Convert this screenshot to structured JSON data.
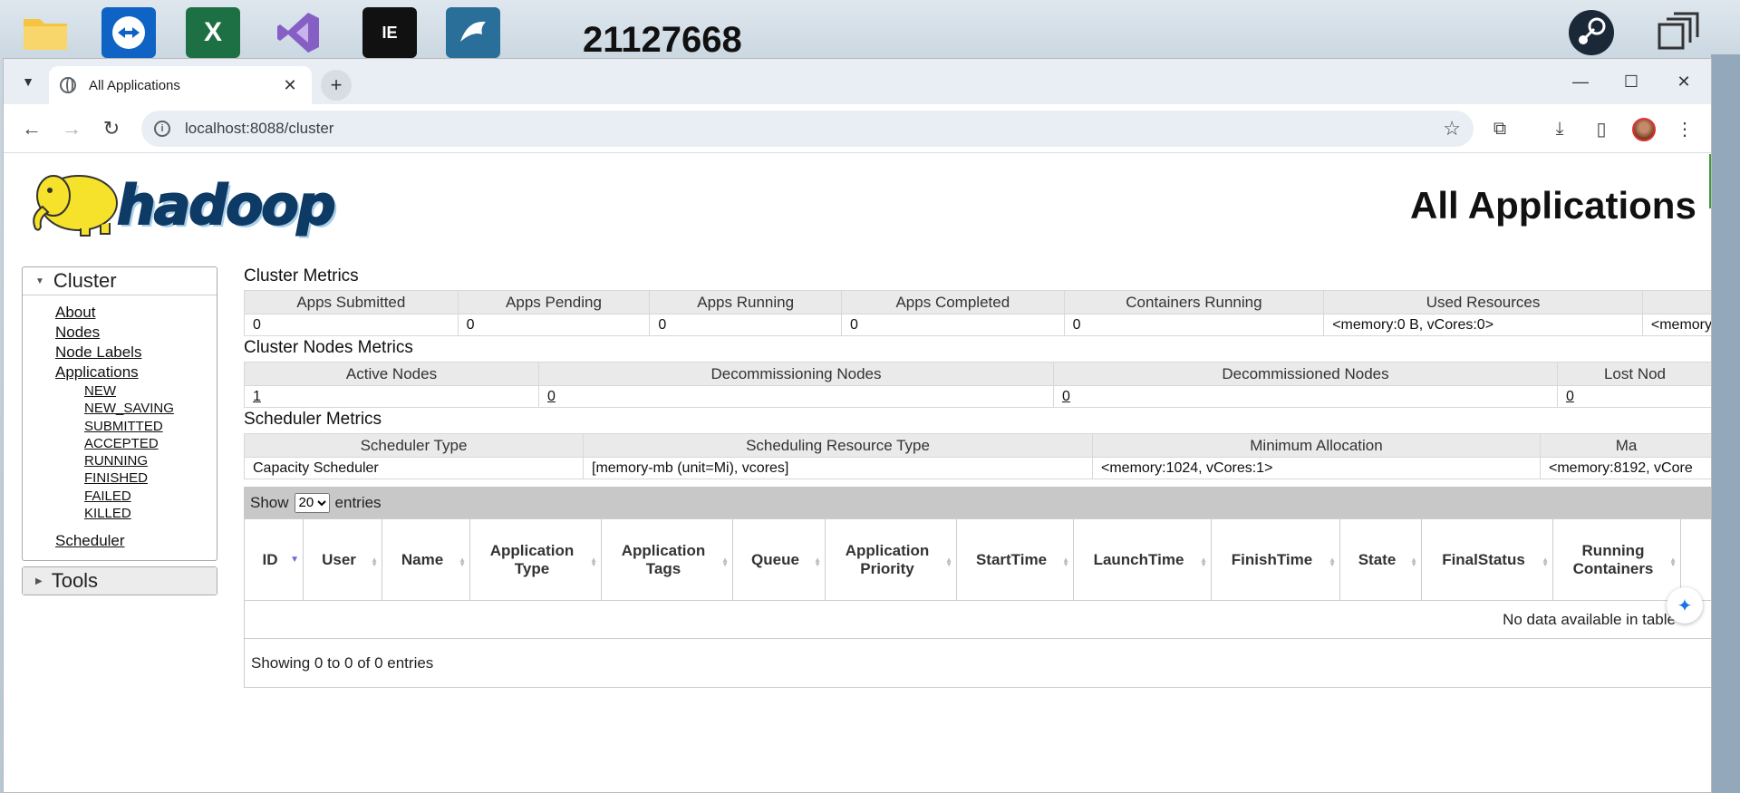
{
  "desktop": {
    "number_label": "21127668",
    "icons": [
      {
        "name": "folder-icon",
        "color": "#f1c40f"
      },
      {
        "name": "teamviewer-icon",
        "color": "#0e63c4"
      },
      {
        "name": "excel-icon",
        "color": "#1d7044",
        "glyph": "X"
      },
      {
        "name": "visual-studio-icon",
        "color": "#865fc5"
      },
      {
        "name": "intellij-icon",
        "color": "#1a1a2e",
        "glyph": "IE"
      },
      {
        "name": "mysql-workbench-icon",
        "color": "#2a6e9a"
      },
      {
        "name": "steam-icon",
        "color": "#1b2838"
      },
      {
        "name": "task-view-icon",
        "color": "#333333"
      }
    ]
  },
  "browser": {
    "tab_title": "All Applications",
    "url": "localhost:8088/cluster"
  },
  "page": {
    "title": "All Applications",
    "logo_text": "hadoop"
  },
  "sidebar": {
    "cluster": {
      "label": "Cluster",
      "links": [
        "About",
        "Nodes",
        "Node Labels",
        "Applications"
      ],
      "app_states": [
        "NEW",
        "NEW_SAVING",
        "SUBMITTED",
        "ACCEPTED",
        "RUNNING",
        "FINISHED",
        "FAILED",
        "KILLED"
      ],
      "scheduler": "Scheduler"
    },
    "tools": {
      "label": "Tools"
    }
  },
  "cluster_metrics": {
    "title": "Cluster Metrics",
    "headers": [
      "Apps Submitted",
      "Apps Pending",
      "Apps Running",
      "Apps Completed",
      "Containers Running",
      "Used Resources",
      ""
    ],
    "values": [
      "0",
      "0",
      "0",
      "0",
      "0",
      "<memory:0 B, vCores:0>",
      "<memory"
    ]
  },
  "nodes_metrics": {
    "title": "Cluster Nodes Metrics",
    "headers": [
      "Active Nodes",
      "Decommissioning Nodes",
      "Decommissioned Nodes",
      "Lost Nod"
    ],
    "values": [
      "1",
      "0",
      "0",
      "0"
    ]
  },
  "scheduler_metrics": {
    "title": "Scheduler Metrics",
    "headers": [
      "Scheduler Type",
      "Scheduling Resource Type",
      "Minimum Allocation",
      "Ma"
    ],
    "values": [
      "Capacity Scheduler",
      "[memory-mb (unit=Mi), vcores]",
      "<memory:1024, vCores:1>",
      "<memory:8192, vCore"
    ]
  },
  "apps_table": {
    "show_label": "Show",
    "entries_label": "entries",
    "page_size": "20",
    "columns": [
      "ID",
      "User",
      "Name",
      "Application Type",
      "Application Tags",
      "Queue",
      "Application Priority",
      "StartTime",
      "LaunchTime",
      "FinishTime",
      "State",
      "FinalStatus",
      "Running Containers"
    ],
    "empty_message": "No data available in table",
    "info": "Showing 0 to 0 of 0 entries"
  }
}
